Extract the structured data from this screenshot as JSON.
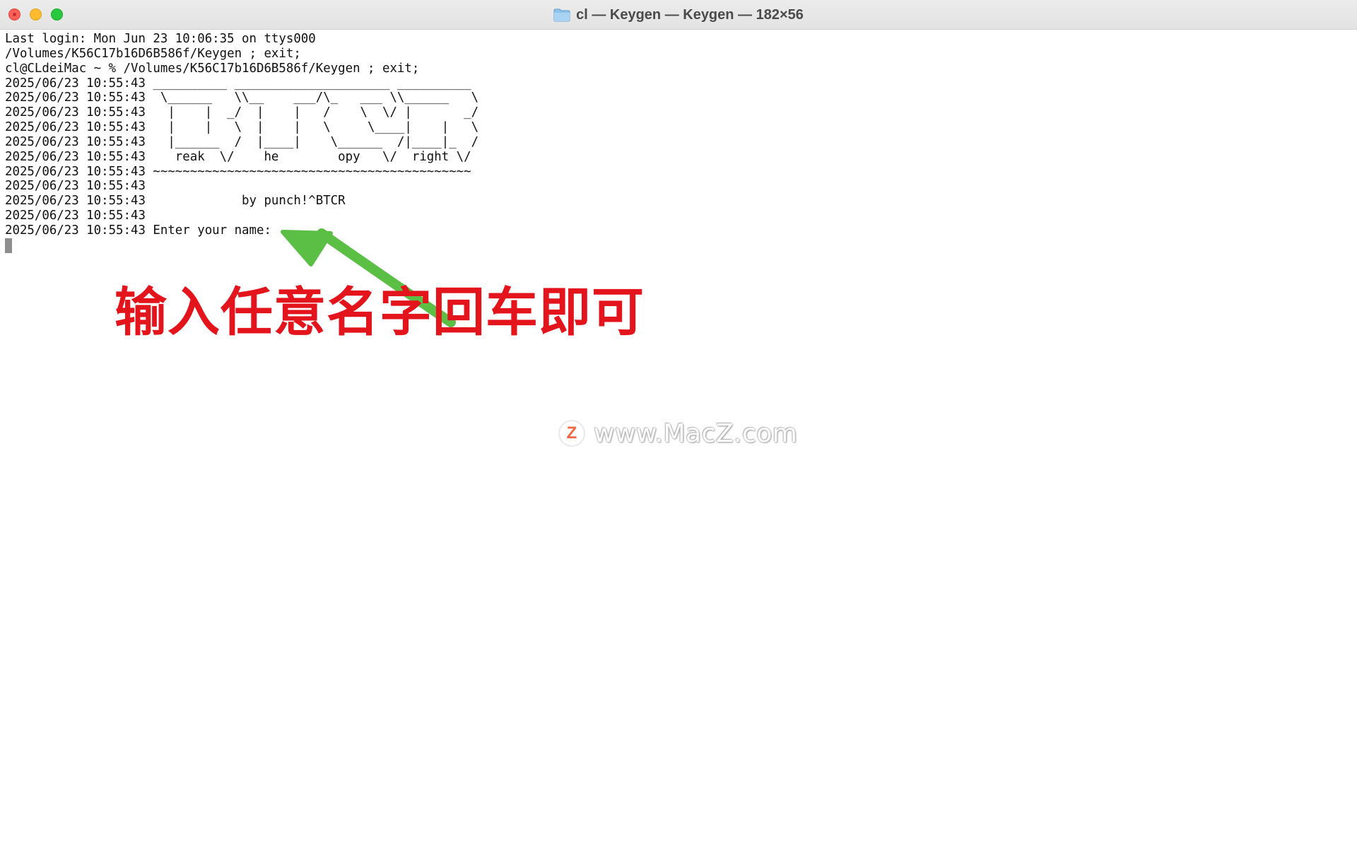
{
  "window": {
    "title": "cl — Keygen — Keygen — 182×56",
    "title_icon": "folder-icon"
  },
  "terminal": {
    "lines": [
      "Last login: Mon Jun 23 10:06:35 on ttys000",
      "/Volumes/K56C17b16D6B586f/Keygen ; exit;",
      "cl@CLdeiMac ~ % /Volumes/K56C17b16D6B586f/Keygen ; exit;",
      "2025/06/23 10:55:43 __________ _____________________ __________",
      "2025/06/23 10:55:43  \\______   \\\\__    ___/\\_   ___ \\\\______   \\",
      "2025/06/23 10:55:43   |    |  _/  |    |   /    \\  \\/ |       _/",
      "2025/06/23 10:55:43   |    |   \\  |    |   \\     \\____|    |   \\",
      "2025/06/23 10:55:43   |______  /  |____|    \\______  /|____|_  /",
      "2025/06/23 10:55:43    reak  \\/    he        opy   \\/  right \\/",
      "2025/06/23 10:55:43 ~~~~~~~~~~~~~~~~~~~~~~~~~~~~~~~~~~~~~~~~~~~",
      "2025/06/23 10:55:43",
      "2025/06/23 10:55:43             by punch!^BTCR",
      "2025/06/23 10:55:43",
      "2025/06/23 10:55:43 Enter your name:"
    ]
  },
  "annotation": {
    "text": "输入任意名字回车即可",
    "color": "#e3141b",
    "arrow_color": "#5cbf45"
  },
  "watermark": {
    "logo_letter": "Z",
    "text": "www.MacZ.com"
  },
  "colors": {
    "close": "#fe5f57",
    "minimize": "#febc2e",
    "maximize": "#28c840"
  }
}
